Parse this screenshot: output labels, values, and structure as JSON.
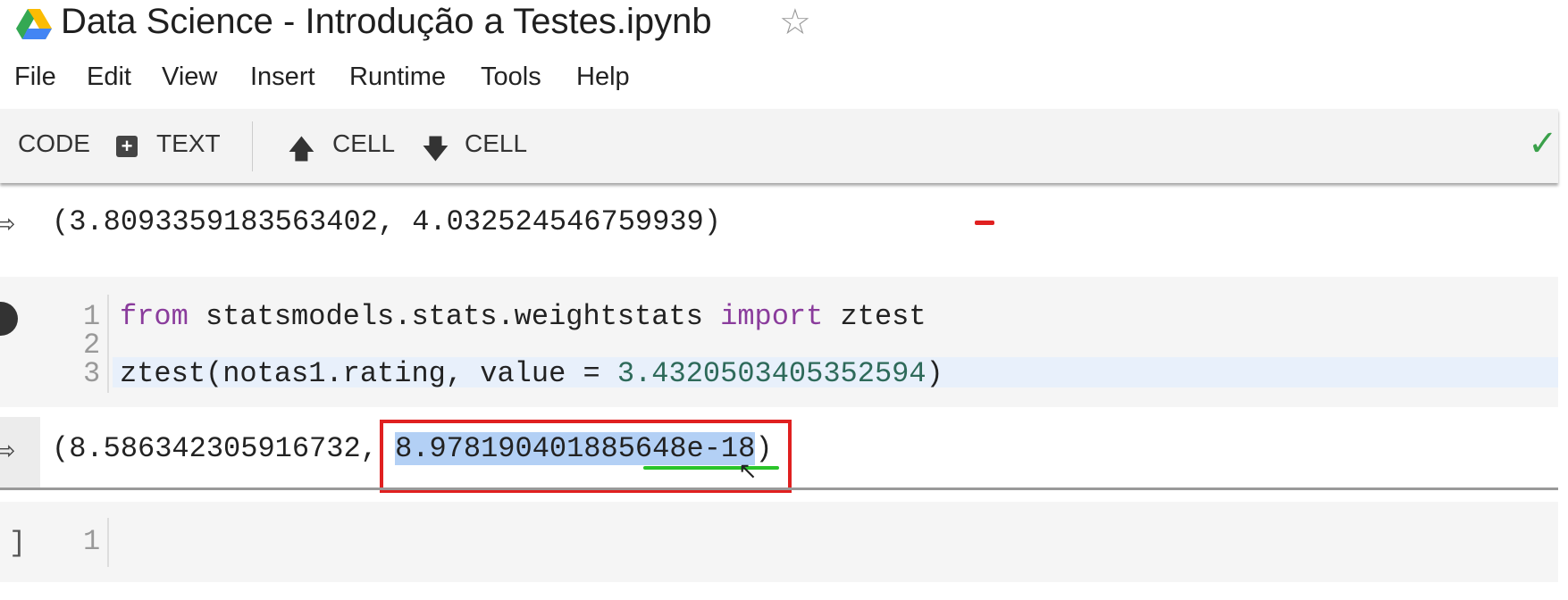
{
  "header": {
    "title": "Data Science - Introdução a Testes.ipynb",
    "logo_icon": "google-drive-icon",
    "star_icon": "star-icon"
  },
  "menu": [
    "File",
    "Edit",
    "View",
    "Insert",
    "Runtime",
    "Tools",
    "Help"
  ],
  "toolbar": {
    "code": "CODE",
    "text": "TEXT",
    "cell_up": "CELL",
    "cell_down": "CELL",
    "status_icon": "checkmark-icon",
    "status_color": "#3aa04a"
  },
  "cells": {
    "output1": "(3.8093359183563402, 4.032524546759939)",
    "code": {
      "line_numbers": [
        "1",
        "2",
        "3"
      ],
      "line1": {
        "kw1": "from",
        "mod": " statsmodels.stats.weightstats ",
        "kw2": "import",
        "rest": " ztest"
      },
      "line3": {
        "call": "ztest(notas1.rating, value = ",
        "num": "3.4320503405352594",
        "close": ")"
      }
    },
    "output2": {
      "prefix": "(8.586342305916732, ",
      "selected": "8.978190401885648e-18",
      "suffix": ")"
    },
    "next": {
      "bracket": "]",
      "line_number": "1"
    }
  },
  "annotations": {
    "box_color": "#e02020",
    "underline_color": "#2ac42a",
    "selection_color": "#b3d0f5"
  }
}
